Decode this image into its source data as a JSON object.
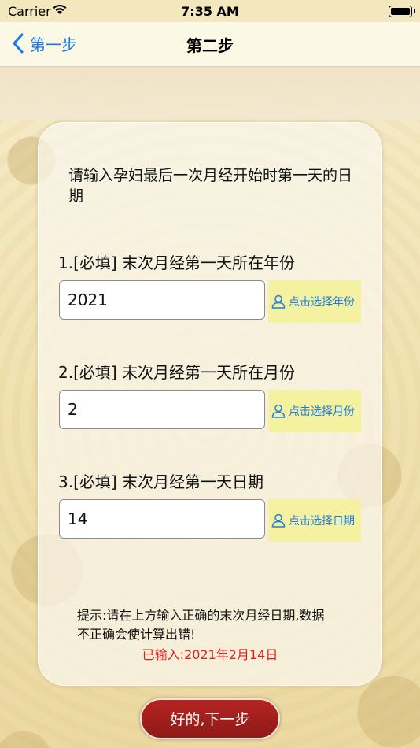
{
  "status_bar": {
    "carrier": "Carrier",
    "time": "7:35 AM"
  },
  "nav": {
    "back_label": "第一步",
    "title": "第二步"
  },
  "intro": "请输入孕妇最后一次月经开始时第一天的日期",
  "fields": [
    {
      "label": "1.[必填] 末次月经第一天所在年份",
      "value": "2021",
      "button": "点击选择年份"
    },
    {
      "label": "2.[必填] 末次月经第一天所在月份",
      "value": "2",
      "button": "点击选择月份"
    },
    {
      "label": "3.[必填] 末次月经第一天日期",
      "value": "14",
      "button": "点击选择日期"
    }
  ],
  "hint": "提示:请在上方输入正确的末次月经日期,数据不正确会使计算出错!",
  "entered": "已输入:2021年2月14日",
  "next_button": "好的,下一步",
  "colors": {
    "accent": "#1677f5",
    "button_red": "#a01f1c",
    "pick_bg": "#f4f2a0",
    "error": "#e02020"
  }
}
